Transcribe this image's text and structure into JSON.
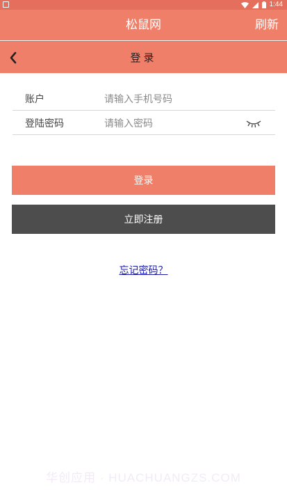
{
  "status_bar": {
    "time": "1:44"
  },
  "header": {
    "title": "松鼠网",
    "refresh_label": "刷新"
  },
  "nav": {
    "title": "登录"
  },
  "form": {
    "account_label": "账户",
    "account_placeholder": "请输入手机号码",
    "password_label": "登陆密码",
    "password_placeholder": "请输入密码"
  },
  "buttons": {
    "login_label": "登录",
    "register_label": "立即注册"
  },
  "forgot_password": "忘记密码？",
  "watermark": "华创应用 · HUACHUANGZS.COM",
  "colors": {
    "brand": "#f07f6a",
    "status_bar": "#e46f5c",
    "register_button": "#4d4d4d",
    "link": "#1a1aa8"
  }
}
